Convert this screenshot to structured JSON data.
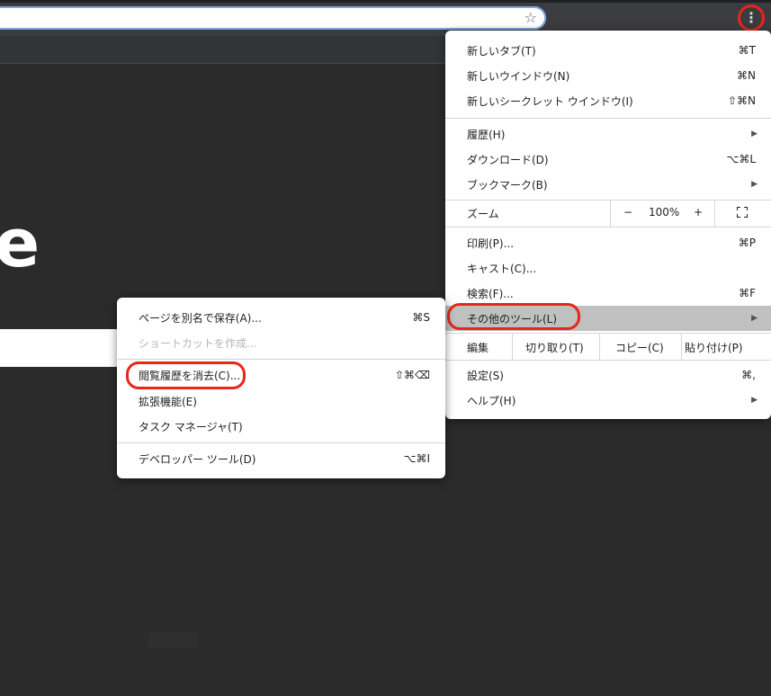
{
  "main_menu": {
    "new_tab": "新しいタブ(T)",
    "new_tab_sc": "⌘T",
    "new_window": "新しいウインドウ(N)",
    "new_window_sc": "⌘N",
    "new_incognito": "新しいシークレット ウインドウ(I)",
    "new_incognito_sc": "⇧⌘N",
    "history": "履歴(H)",
    "downloads": "ダウンロード(D)",
    "downloads_sc": "⌥⌘L",
    "bookmarks": "ブックマーク(B)",
    "zoom": "ズーム",
    "zoom_minus": "−",
    "zoom_value": "100%",
    "zoom_plus": "+",
    "print": "印刷(P)...",
    "print_sc": "⌘P",
    "cast": "キャスト(C)...",
    "find": "検索(F)...",
    "find_sc": "⌘F",
    "more_tools": "その他のツール(L)",
    "edit": "編集",
    "cut": "切り取り(T)",
    "copy": "コピー(C)",
    "paste": "貼り付け(P)",
    "settings": "設定(S)",
    "settings_sc": "⌘,",
    "help": "ヘルプ(H)"
  },
  "sub_menu": {
    "save_page": "ページを別名で保存(A)...",
    "save_page_sc": "⌘S",
    "create_shortcut": "ショートカットを作成...",
    "clear_data": "閲覧履歴を消去(C)...",
    "clear_data_sc": "⇧⌘⌫",
    "extensions": "拡張機能(E)",
    "task_manager": "タスク マネージャ(T)",
    "devtools": "デベロッパー ツール(D)",
    "devtools_sc": "⌥⌘I"
  },
  "page": {
    "big_letter": "e"
  },
  "icons": {
    "star": "☆",
    "kebab": "⋮",
    "arrow": "▶"
  },
  "colors": {
    "highlight_ring": "#e8261a",
    "menu_hover": "#c0c0c0"
  }
}
